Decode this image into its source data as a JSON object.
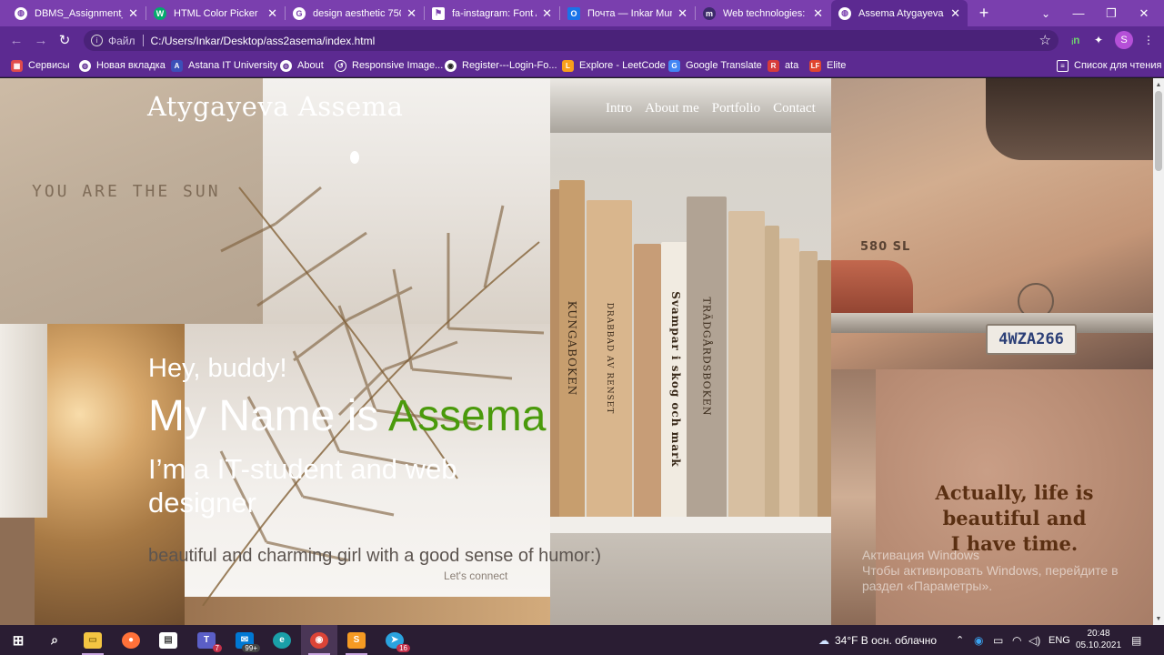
{
  "browser": {
    "tabs": [
      {
        "title": "DBMS_Assignment_4.",
        "icon": "globe-icon"
      },
      {
        "title": "HTML Color Picker",
        "icon": "w3schools-icon"
      },
      {
        "title": "design aesthetic 750x",
        "icon": "google-icon"
      },
      {
        "title": "fa-instagram: Font Aw",
        "icon": "flag-icon"
      },
      {
        "title": "Почта — Inkar Munb",
        "icon": "outlook-icon"
      },
      {
        "title": "Web technologies: As",
        "icon": "moodle-icon"
      },
      {
        "title": "Assema Atygayeva",
        "icon": "globe-icon"
      }
    ],
    "address": {
      "protocol": "Файл",
      "url": "C:/Users/Inkar/Desktop/ass2asema/index.html"
    },
    "profile_initial": "S",
    "bookmarks": [
      {
        "label": "Сервисы",
        "color": "#e04b4b"
      },
      {
        "label": "Новая вкладка",
        "color": "#ffffff"
      },
      {
        "label": "Astana IT University",
        "color": "#3c4fb8"
      },
      {
        "label": "About",
        "color": "#ffffff"
      },
      {
        "label": "Responsive Image...",
        "color": "#ffffff"
      },
      {
        "label": "Register---Login-Fo...",
        "color": "#ffffff"
      },
      {
        "label": "Explore - LeetCode",
        "color": "#f89f1b"
      },
      {
        "label": "Google Translate",
        "color": "#4285f4"
      },
      {
        "label": "ata",
        "color": "#d63b3b"
      },
      {
        "label": "Elite",
        "color": "#e0452f"
      }
    ],
    "reading_list": "Список для чтения"
  },
  "site": {
    "brand": "Atygayeva Assema",
    "nav": [
      "Intro",
      "About me",
      "Portfolio",
      "Contact"
    ],
    "sun_text": "YOU ARE THE SUN",
    "greeting": "Hey, buddy!",
    "name_prefix": "My Name is ",
    "name_accent": "Assema",
    "accent_color": "#4a9a0b",
    "role": "I’m a IT-student and web designer",
    "description": "beautiful and charming girl with a good sense of humor:)",
    "cta": "Let's connect",
    "quote": [
      "Actually, life is",
      "beautiful and",
      "I have time."
    ],
    "book_titles": [
      "KUNGABOKEN",
      "DRABBAD AV RENSET",
      "Svampar i skog och mark",
      "TRÄDGÅRDSBOKEN"
    ],
    "car_badge": "580 SL",
    "car_plate": "4WZA266",
    "activate_windows": {
      "title": "Активация Windows",
      "text": "Чтобы активировать Windows, перейдите в раздел «Параметры»."
    }
  },
  "taskbar": {
    "weather": "34°F  В осн. облачно",
    "language": "ENG",
    "time": "20:48",
    "date": "05.10.2021",
    "mail_badge": "99+",
    "teams_badge": "7",
    "telegram_badge": "16"
  }
}
